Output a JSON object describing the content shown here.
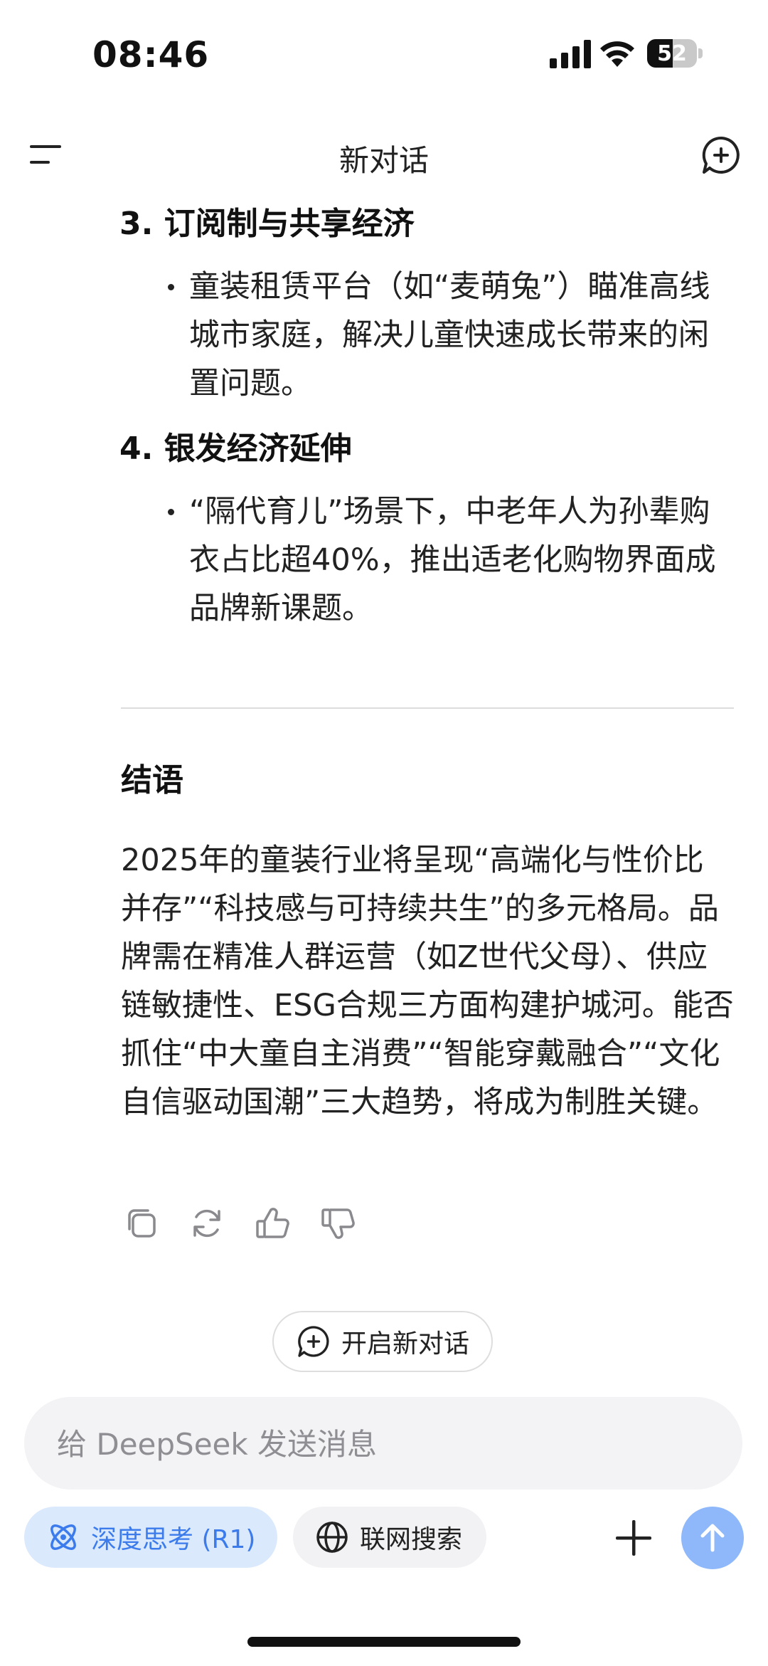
{
  "status_bar": {
    "time": "08:46",
    "battery_level": "52",
    "icons": [
      "signal-icon",
      "wifi-icon",
      "battery-icon"
    ]
  },
  "header": {
    "title": "新对话",
    "icons": [
      "menu-icon",
      "new-chat-icon"
    ]
  },
  "content": {
    "items": [
      {
        "heading": "3. 订阅制与共享经济",
        "bullet": "童装租赁平台（如“麦萌兔”）瞄准高线城市家庭，解决儿童快速成长带来的闲置问题。"
      },
      {
        "heading": "4. 银发经济延伸",
        "bullet": "“隔代育儿”场景下，中老年人为孙辈购衣占比超40%，推出适老化购物界面成品牌新课题。"
      }
    ],
    "conclusion_title": "结语",
    "conclusion_text": "2025年的童装行业将呈现“高端化与性价比并存”“科技感与可持续共生”的多元格局。品牌需在精准人群运营（如Z世代父母）、供应链敏捷性、ESG合规三方面构建护城河。能否抓住“中大童自主消费”“智能穿戴融合”“文化自信驱动国潮”三大趋势，将成为制胜关键。"
  },
  "actions": {
    "icons": [
      "copy-icon",
      "regenerate-icon",
      "thumbs-up-icon",
      "thumbs-down-icon"
    ]
  },
  "new_chat_button": {
    "label": "开启新对话"
  },
  "composer": {
    "placeholder": "给 DeepSeek 发送消息",
    "value": "",
    "deep_think_label": "深度思考 (R1)",
    "deep_think_active": true,
    "web_search_label": "联网搜索",
    "web_search_active": false,
    "accent_color": "#3b7bec",
    "send_color": "#8fb8fb"
  }
}
